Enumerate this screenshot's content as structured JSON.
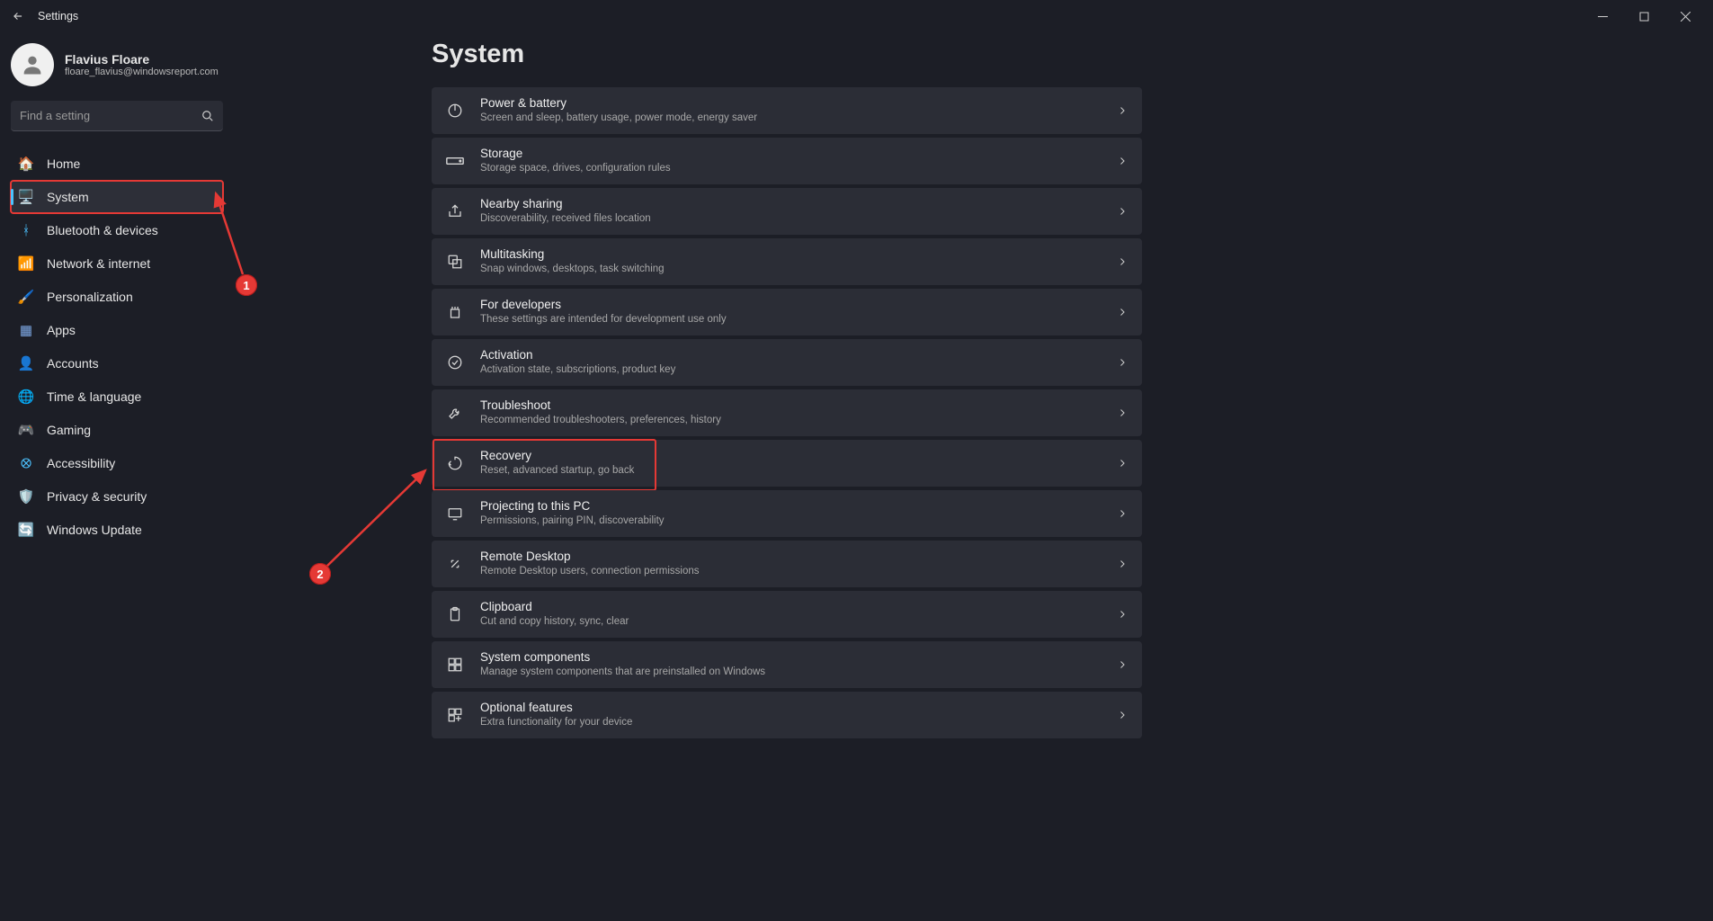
{
  "window": {
    "title": "Settings"
  },
  "profile": {
    "name": "Flavius Floare",
    "email": "floare_flavius@windowsreport.com"
  },
  "search": {
    "placeholder": "Find a setting"
  },
  "nav": [
    {
      "key": "home",
      "label": "Home",
      "icon": "🏠",
      "color": "#e08a3c"
    },
    {
      "key": "system",
      "label": "System",
      "icon": "🖥️",
      "color": "#4cc2ff",
      "active": true,
      "highlight": true
    },
    {
      "key": "bluetooth",
      "label": "Bluetooth & devices",
      "icon": "ᚼ",
      "color": "#4cc2ff"
    },
    {
      "key": "network",
      "label": "Network & internet",
      "icon": "📶",
      "color": "#4cc2ff"
    },
    {
      "key": "personalization",
      "label": "Personalization",
      "icon": "🖌️",
      "color": "#c97fa8"
    },
    {
      "key": "apps",
      "label": "Apps",
      "icon": "▦",
      "color": "#7ea9e6"
    },
    {
      "key": "accounts",
      "label": "Accounts",
      "icon": "👤",
      "color": "#56b36a"
    },
    {
      "key": "time",
      "label": "Time & language",
      "icon": "🌐",
      "color": "#5aa9d6"
    },
    {
      "key": "gaming",
      "label": "Gaming",
      "icon": "🎮",
      "color": "#8c8c8c"
    },
    {
      "key": "accessibility",
      "label": "Accessibility",
      "icon": "⭙",
      "color": "#4cc2ff"
    },
    {
      "key": "privacy",
      "label": "Privacy & security",
      "icon": "🛡️",
      "color": "#8c8c8c"
    },
    {
      "key": "update",
      "label": "Windows Update",
      "icon": "🔄",
      "color": "#4cc2ff"
    }
  ],
  "page": {
    "title": "System"
  },
  "cards": [
    {
      "key": "power",
      "icon": "power",
      "title": "Power & battery",
      "sub": "Screen and sleep, battery usage, power mode, energy saver"
    },
    {
      "key": "storage",
      "icon": "storage",
      "title": "Storage",
      "sub": "Storage space, drives, configuration rules"
    },
    {
      "key": "nearby",
      "icon": "share",
      "title": "Nearby sharing",
      "sub": "Discoverability, received files location"
    },
    {
      "key": "multitask",
      "icon": "windows",
      "title": "Multitasking",
      "sub": "Snap windows, desktops, task switching"
    },
    {
      "key": "developers",
      "icon": "dev",
      "title": "For developers",
      "sub": "These settings are intended for development use only"
    },
    {
      "key": "activation",
      "icon": "check",
      "title": "Activation",
      "sub": "Activation state, subscriptions, product key"
    },
    {
      "key": "troubleshoot",
      "icon": "wrench",
      "title": "Troubleshoot",
      "sub": "Recommended troubleshooters, preferences, history"
    },
    {
      "key": "recovery",
      "icon": "recovery",
      "title": "Recovery",
      "sub": "Reset, advanced startup, go back",
      "highlight": true
    },
    {
      "key": "projecting",
      "icon": "project",
      "title": "Projecting to this PC",
      "sub": "Permissions, pairing PIN, discoverability"
    },
    {
      "key": "remote",
      "icon": "remote",
      "title": "Remote Desktop",
      "sub": "Remote Desktop users, connection permissions"
    },
    {
      "key": "clipboard",
      "icon": "clipboard",
      "title": "Clipboard",
      "sub": "Cut and copy history, sync, clear"
    },
    {
      "key": "components",
      "icon": "components",
      "title": "System components",
      "sub": "Manage system components that are preinstalled on Windows"
    },
    {
      "key": "optional",
      "icon": "optional",
      "title": "Optional features",
      "sub": "Extra functionality for your device"
    }
  ],
  "annotations": {
    "badge1": "1",
    "badge2": "2"
  }
}
